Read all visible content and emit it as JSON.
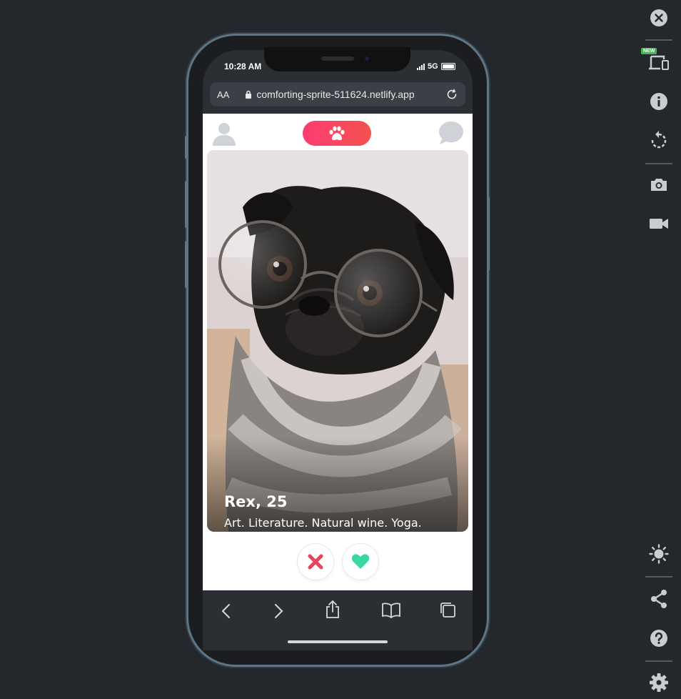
{
  "status_bar": {
    "time": "10:28 AM",
    "network": "5G"
  },
  "browser": {
    "text_size": "AA",
    "url": "comforting-sprite-511624.netlify.app"
  },
  "app": {
    "profile": {
      "name": "Rex, 25",
      "bio": "Art. Literature. Natural wine. Yoga."
    }
  },
  "toolbar": {
    "new_badge": "NEW"
  },
  "colors": {
    "accent_pink": "#fb3d72",
    "like_green": "#3bd6a6",
    "nope_red": "#e5455f",
    "toolbar_icon": "#c9ccd1"
  },
  "icons": [
    "profile-icon",
    "paw-icon",
    "chat-icon",
    "nope-icon",
    "like-heart-icon",
    "back-icon",
    "forward-icon",
    "share-icon",
    "bookmarks-icon",
    "tabs-icon",
    "close-icon",
    "devices-icon",
    "info-icon",
    "rotate-icon",
    "screenshot-icon",
    "video-icon",
    "brightness-icon",
    "share-link-icon",
    "help-icon",
    "settings-icon"
  ]
}
